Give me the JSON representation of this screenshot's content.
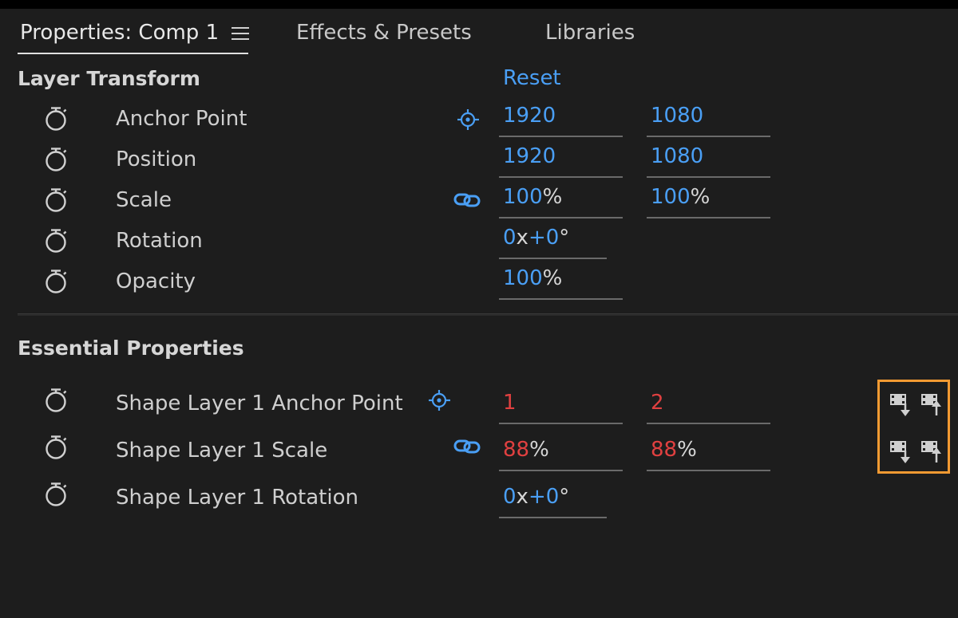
{
  "tabs": {
    "properties": "Properties: Comp 1",
    "effects": "Effects & Presets",
    "libraries": "Libraries"
  },
  "layer_transform": {
    "title": "Layer Transform",
    "reset": "Reset",
    "anchor_point": {
      "label": "Anchor Point",
      "x": "1920",
      "y": "1080"
    },
    "position": {
      "label": "Position",
      "x": "1920",
      "y": "1080"
    },
    "scale": {
      "label": "Scale",
      "x": "100",
      "y": "100",
      "unit": "%"
    },
    "rotation": {
      "label": "Rotation",
      "turns": "0",
      "x": "x",
      "angle": "+0",
      "deg": "°"
    },
    "opacity": {
      "label": "Opacity",
      "value": "100",
      "unit": "%"
    }
  },
  "essential": {
    "title": "Essential Properties",
    "anchor_point": {
      "label": "Shape Layer 1 Anchor Point",
      "x": "1",
      "y": "2"
    },
    "scale": {
      "label": "Shape Layer 1 Scale",
      "x": "88",
      "y": "88",
      "unit": "%"
    },
    "rotation": {
      "label": "Shape Layer 1 Rotation",
      "turns": "0",
      "x": "x",
      "angle": "+0",
      "deg": "°"
    }
  },
  "colors": {
    "accent": "#4a9ff5",
    "override": "#e04040",
    "highlight": "#f29a32",
    "background": "#1d1d1d"
  },
  "icons": [
    "menu-icon",
    "stopwatch-icon",
    "anchor-target-icon",
    "link-icon",
    "push-to-master-icon",
    "pull-from-master-icon"
  ]
}
